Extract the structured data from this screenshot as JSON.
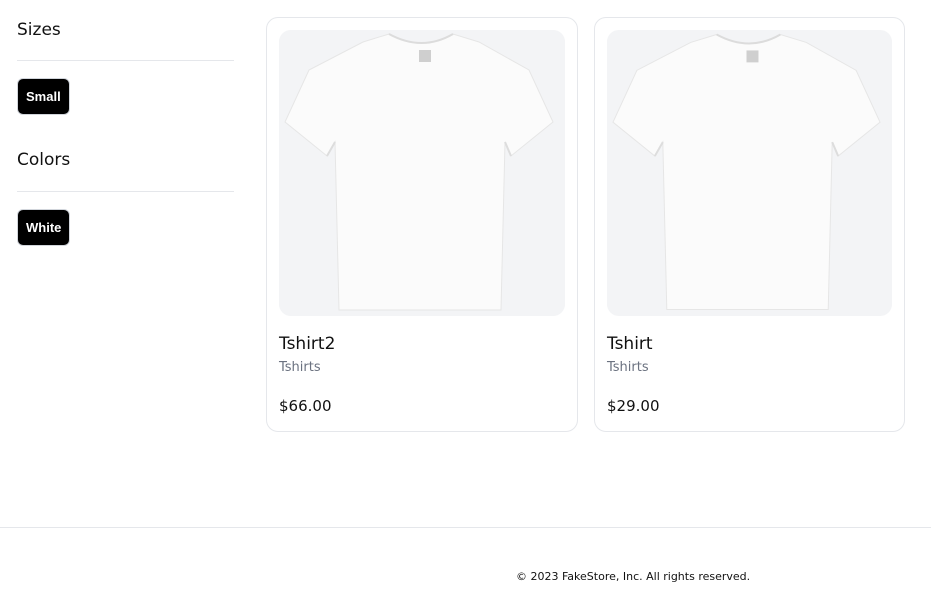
{
  "filters": {
    "sizes": {
      "title": "Sizes",
      "options": [
        "Small"
      ]
    },
    "colors": {
      "title": "Colors",
      "options": [
        "White"
      ]
    }
  },
  "products": [
    {
      "name": "Tshirt2",
      "category": "Tshirts",
      "price": "$66.00",
      "image": "white-tshirt-image"
    },
    {
      "name": "Tshirt",
      "category": "Tshirts",
      "price": "$29.00",
      "image": "white-tshirt-image"
    }
  ],
  "footer": {
    "copyright": "© 2023 FakeStore, Inc. All rights reserved."
  }
}
